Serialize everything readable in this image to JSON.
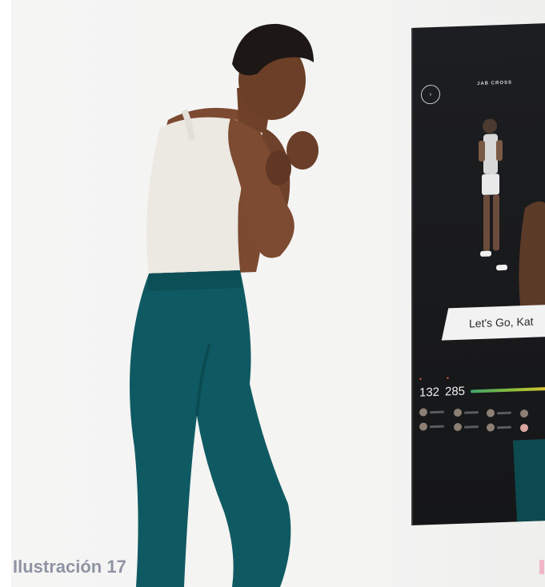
{
  "caption": "Ilustración 17",
  "mirror": {
    "trainer_name": "JAB CROSS",
    "banner": "Let's Go, Kat",
    "stats": [
      {
        "value": "132"
      },
      {
        "value": "285"
      }
    ]
  },
  "colors": {
    "leggings": "#0f5a62",
    "top": "#ece8e2",
    "skin": "#7a4a31",
    "mirror_screen": "#1b1c1f",
    "caption": "#8f93a2",
    "accent_bar": "#3fa36a"
  }
}
